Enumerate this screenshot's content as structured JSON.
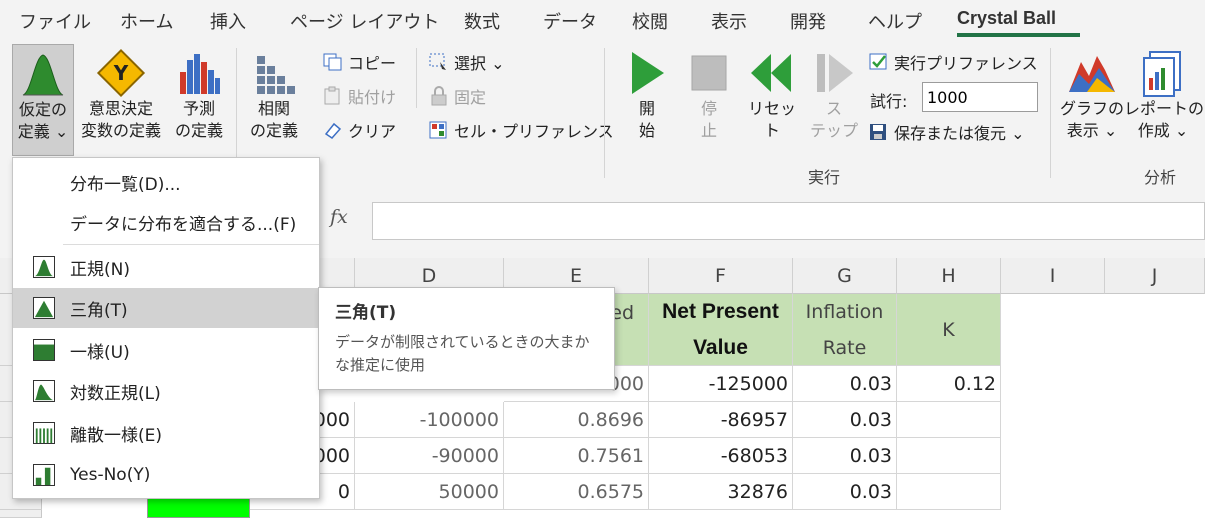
{
  "ribbon_tabs": [
    "ファイル",
    "ホーム",
    "挿入",
    "ページ レイアウト",
    "数式",
    "データ",
    "校閲",
    "表示",
    "開発",
    "ヘルプ",
    "Crystal Ball"
  ],
  "active_tab": "Crystal Ball",
  "ribbon": {
    "define_assumption": [
      "仮定の",
      "定義 ⌄"
    ],
    "define_decision": [
      "意思決定",
      "変数の定義"
    ],
    "define_forecast": [
      "予測",
      "の定義"
    ],
    "define_correlation": [
      "相関",
      "の定義"
    ],
    "copy": "コピー",
    "paste": "貼付け",
    "clear": "クリア",
    "select": "選択 ⌄",
    "freeze": "固定",
    "cell_preferences": "セル・プリファレンス",
    "start": [
      "開",
      "始"
    ],
    "stop": [
      "停",
      "止"
    ],
    "reset": [
      "リセッ",
      "ト"
    ],
    "step": [
      "ス",
      "テップ"
    ],
    "run_preferences": "実行プリファレンス",
    "trials_label": "試行:",
    "trials_value": "1000",
    "save_restore": "保存または復元 ⌄",
    "group_run": "実行",
    "view_charts": [
      "グラフの",
      "表示 ⌄"
    ],
    "create_report": [
      "レポートの",
      "作成 ⌄"
    ],
    "group_analyze": "分析"
  },
  "formula_bar": {
    "fx": "fx",
    "value": ""
  },
  "columns": [
    "D",
    "E",
    "F",
    "G",
    "H",
    "I",
    "J"
  ],
  "headers": {
    "e_partial": "ed",
    "f_line1": "Net Present",
    "f_line2": "Value",
    "g_line1": "Inflation",
    "g_line2": "Rate",
    "h": "K"
  },
  "rows": [
    {
      "c": "",
      "d": "",
      "e": "000",
      "f": "-125000",
      "g": "0.03",
      "h": "0.12"
    },
    {
      "c": "000",
      "d": "-100000",
      "e": "0.8696",
      "f": "-86957",
      "g": "0.03",
      "h": ""
    },
    {
      "c": "000",
      "d": "-90000",
      "e": "0.7561",
      "f": "-68053",
      "g": "0.03",
      "h": ""
    },
    {
      "c": "0",
      "d": "50000",
      "e": "0.6575",
      "f": "32876",
      "g": "0.03",
      "h": ""
    }
  ],
  "dropdown": {
    "gallery": "分布一覧(D)...",
    "fit": "データに分布を適合する...(F)",
    "items": [
      {
        "label": "正規(N)",
        "icon": "normal-distribution-icon"
      },
      {
        "label": "三角(T)",
        "icon": "triangular-distribution-icon"
      },
      {
        "label": "一様(U)",
        "icon": "uniform-distribution-icon"
      },
      {
        "label": "対数正規(L)",
        "icon": "lognormal-distribution-icon"
      },
      {
        "label": "離散一様(E)",
        "icon": "discrete-uniform-distribution-icon"
      },
      {
        "label": "Yes-No(Y)",
        "icon": "yes-no-distribution-icon"
      }
    ]
  },
  "tooltip": {
    "title": "三角(T)",
    "body": "データが制限されているときの大まかな推定に使用"
  },
  "colors": {
    "accent": "#217346",
    "header_fill": "#c6e0b4",
    "highlight_cell": "#00ff00"
  }
}
